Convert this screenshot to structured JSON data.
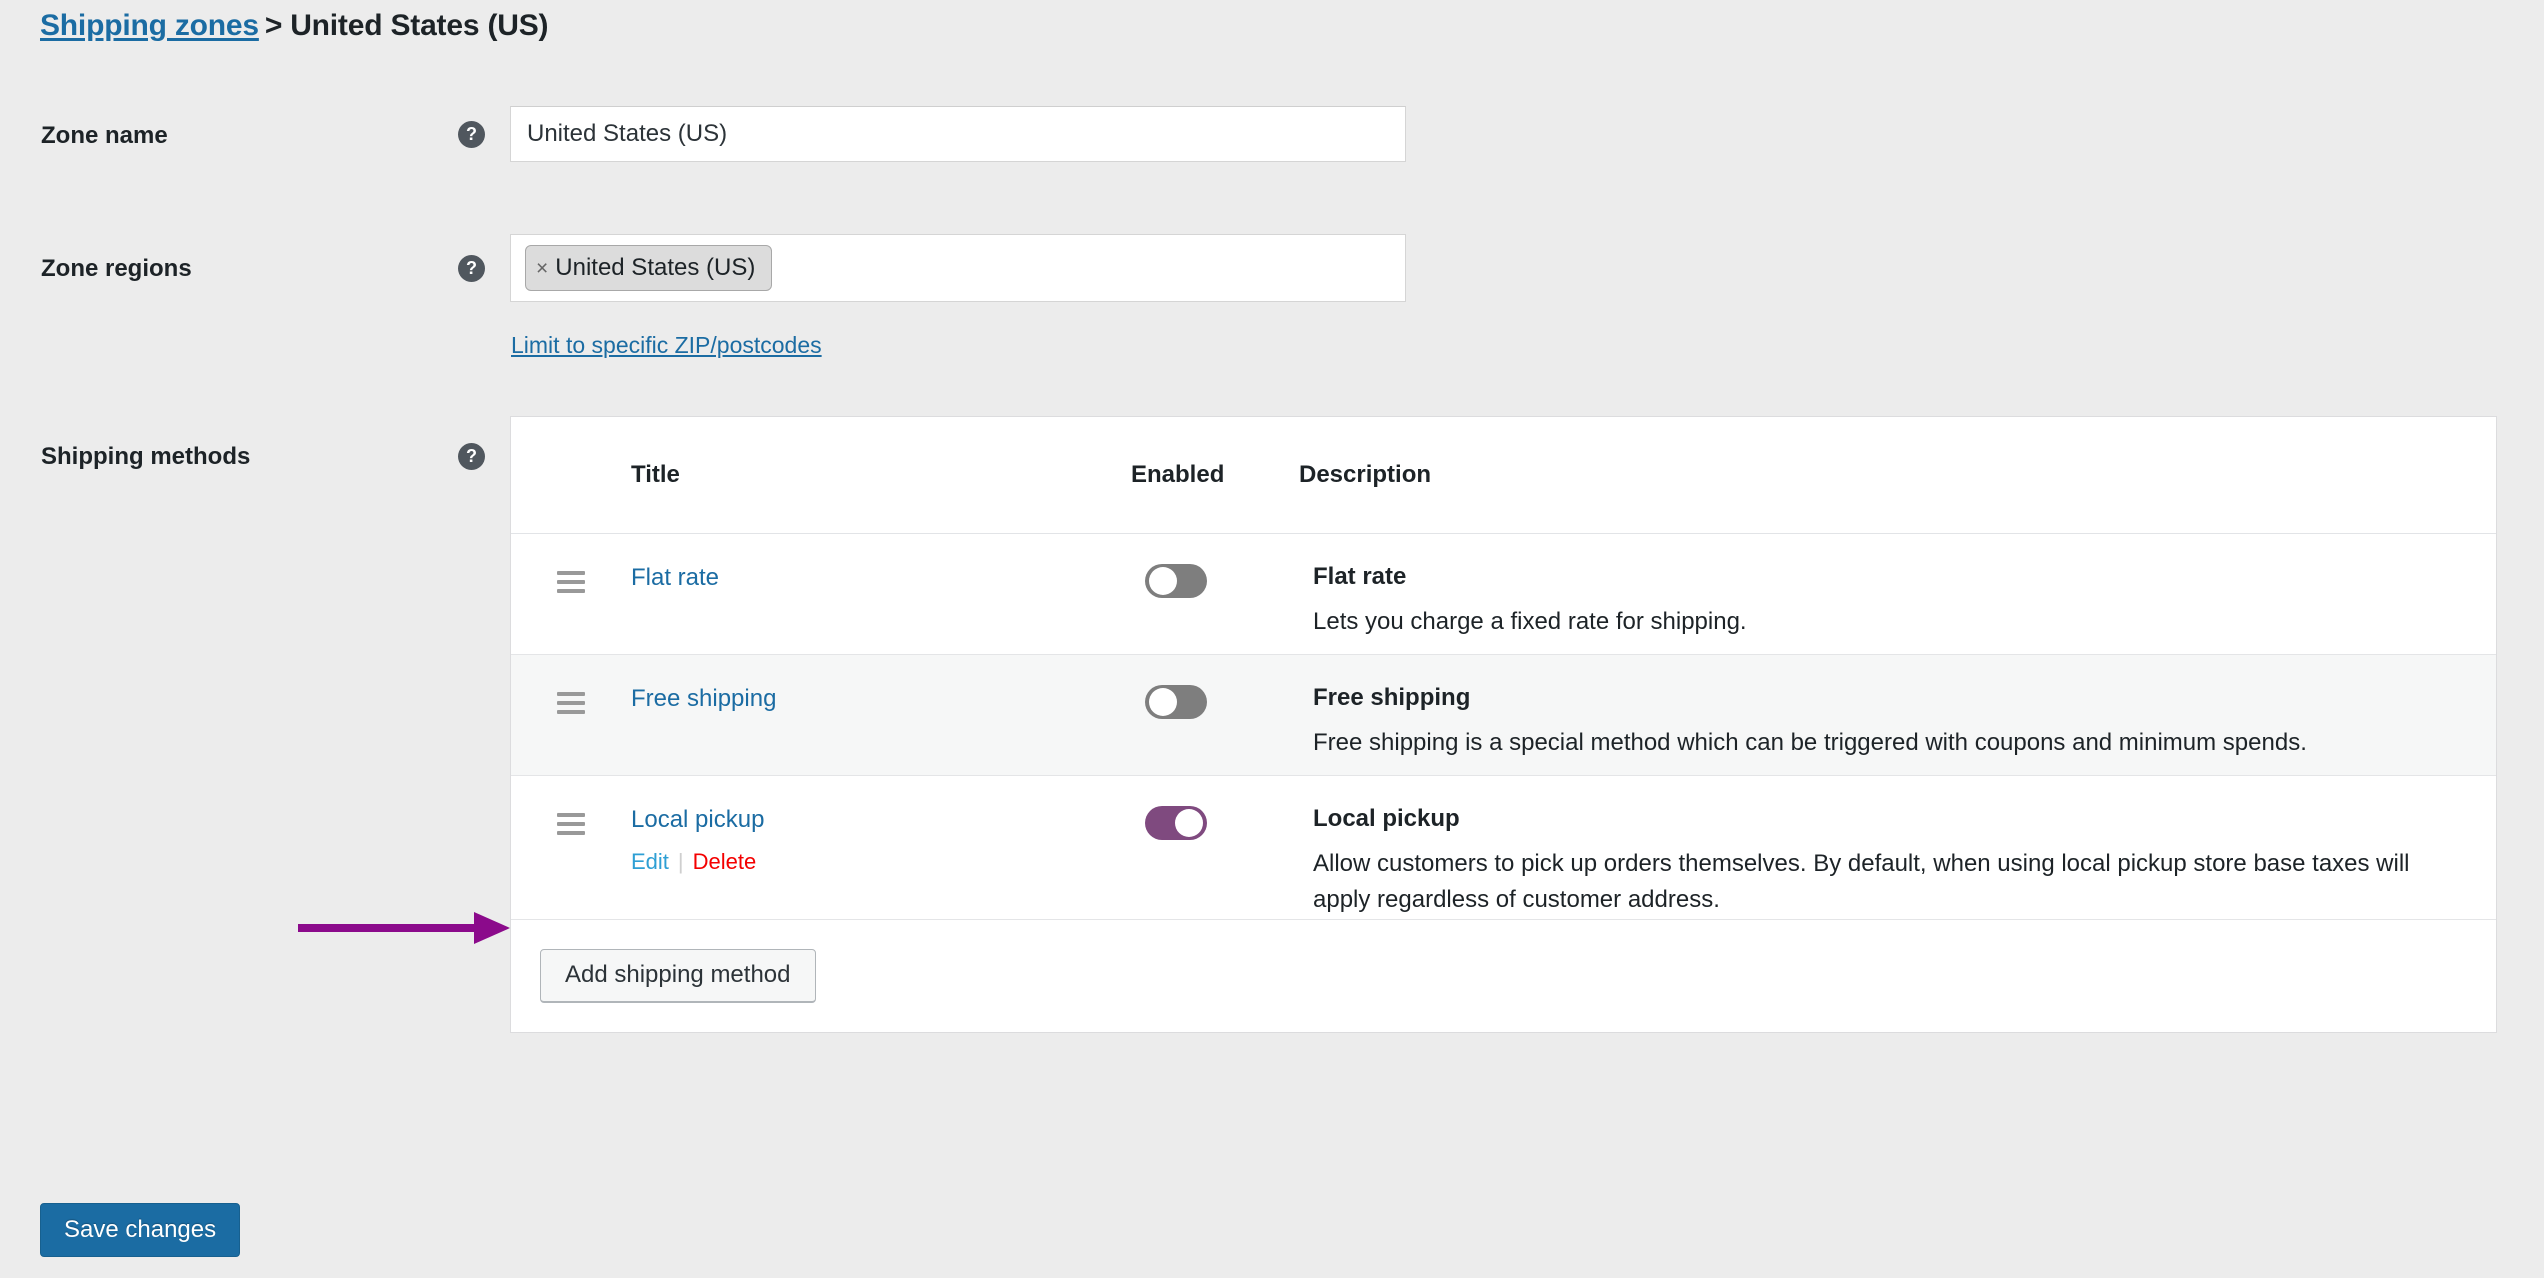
{
  "breadcrumb": {
    "parent_link": "Shipping zones",
    "separator": ">",
    "current": "United States (US)"
  },
  "form": {
    "zone_name": {
      "label": "Zone name",
      "help_icon": "question-mark-icon",
      "value": "United States (US)",
      "placeholder": "Zone name"
    },
    "zone_regions": {
      "label": "Zone regions",
      "help_icon": "question-mark-icon",
      "chips": [
        {
          "remove_glyph": "×",
          "label": "United States (US)"
        }
      ],
      "limit_link": "Limit to specific ZIP/postcodes"
    },
    "shipping_methods": {
      "label": "Shipping methods",
      "help_icon": "question-mark-icon"
    }
  },
  "methods_table": {
    "headers": {
      "handle": "",
      "title": "Title",
      "enabled": "Enabled",
      "description": "Description"
    },
    "rows": [
      {
        "handle_icon": "drag-handle-icon",
        "title": "Flat rate",
        "enabled": false,
        "desc_title": "Flat rate",
        "desc_body": "Lets you charge a fixed rate for shipping.",
        "actions": null
      },
      {
        "handle_icon": "drag-handle-icon",
        "title": "Free shipping",
        "enabled": false,
        "desc_title": "Free shipping",
        "desc_body": "Free shipping is a special method which can be triggered with coupons and minimum spends.",
        "actions": null
      },
      {
        "handle_icon": "drag-handle-icon",
        "title": "Local pickup",
        "enabled": true,
        "desc_title": "Local pickup",
        "desc_body": "Allow customers to pick up orders themselves. By default, when using local pickup store base taxes will apply regardless of customer address.",
        "actions": {
          "edit": "Edit",
          "separator": "|",
          "delete": "Delete"
        }
      }
    ],
    "add_method_button": "Add shipping method"
  },
  "footer": {
    "save_button": "Save changes"
  },
  "annotation": {
    "arrow_color": "#8b0a8b",
    "points_to": "Local pickup"
  },
  "colors": {
    "page_background": "#ececec",
    "link_blue": "#1b6ca3",
    "toggle_on": "#7f4a7f",
    "toggle_off": "#7e7e7e",
    "delete_red": "#f40000",
    "edit_blue": "#2e9fd4",
    "primary_button": "#1b6ca3"
  }
}
